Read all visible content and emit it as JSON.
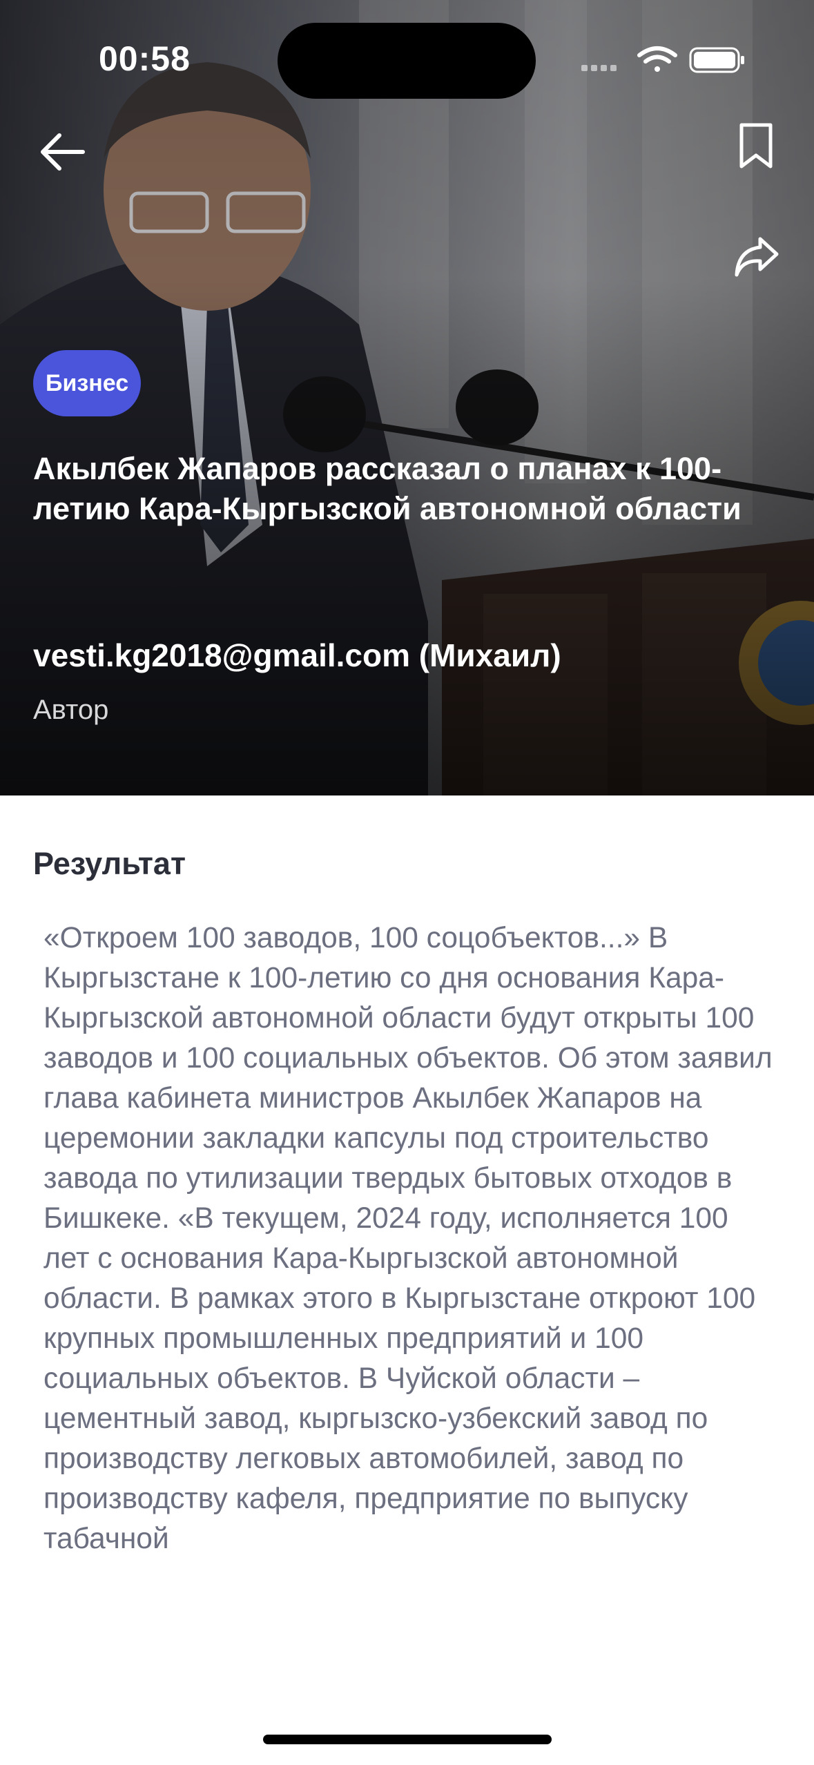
{
  "status_bar": {
    "time": "00:58",
    "icons": [
      "signal-icon",
      "wifi-icon",
      "battery-icon"
    ]
  },
  "header": {
    "back_icon": "back-arrow-icon",
    "bookmark_icon": "bookmark-icon",
    "share_icon": "share-icon"
  },
  "article": {
    "category": "Бизнес",
    "category_color": "#4a55db",
    "title": "Акылбек Жапаров рассказал о планах к 100-летию Кара-Кыргызской автономной области",
    "author_name": "vesti.kg2018@gmail.com (Михаил)",
    "author_role": "Автор",
    "section_title": "Результат",
    "body": "«Откроем 100 заводов, 100 соцобъектов...» В Кыргызстане к 100-летию со дня основания Кара-Кыргызской автономной области будут открыты 100 заводов и 100 социальных объектов. Об этом заявил глава кабинета министров Акылбек Жапаров на церемонии закладки капсулы под строительство завода по утилизации твердых бытовых отходов в Бишкеке. «В текущем, 2024 году, исполняется 100 лет с основания Кара-Кыргызской автономной области. В рамках этого в Кыргызстане откроют 100 крупных промышленных предприятий и 100 социальных объектов. В Чуйской области – цементный завод, кыргызско-узбекский завод по производству легковых автомобилей, завод по производству кафеля, предприятие по выпуску табачной"
  }
}
